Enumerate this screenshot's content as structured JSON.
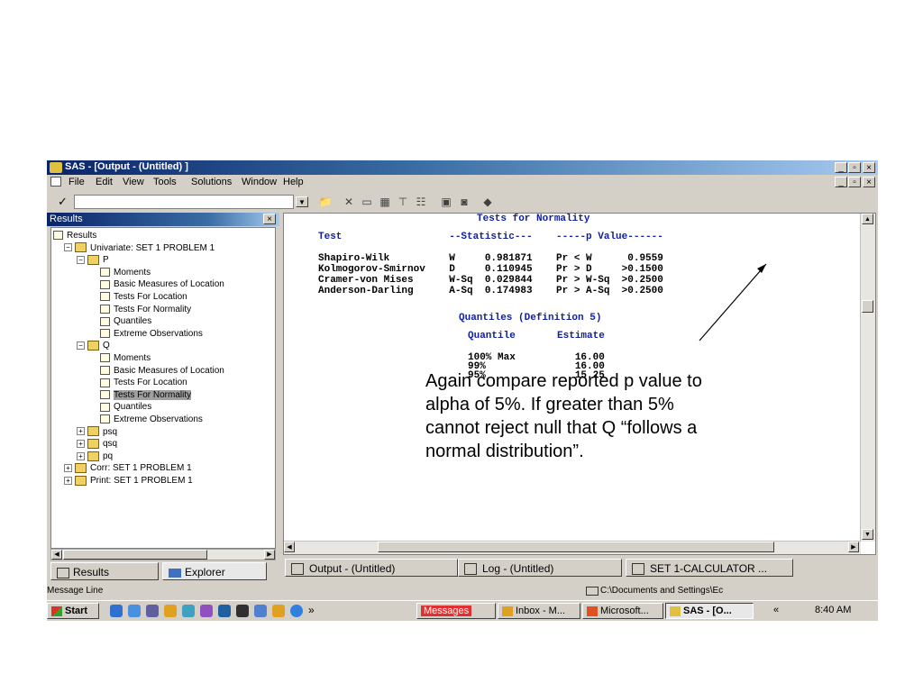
{
  "window": {
    "title": "SAS - [Output - (Untitled) ]",
    "menus": [
      "File",
      "Edit",
      "View",
      "Tools",
      "Solutions",
      "Window",
      "Help"
    ],
    "command_value": "",
    "check_glyph": "✓",
    "min": "_",
    "max": "▫",
    "close": "×"
  },
  "results_panel": {
    "header": "Results",
    "close": "×",
    "tree": [
      {
        "label": "Results",
        "level": 0,
        "kind": "root"
      },
      {
        "label": "Univariate:  SET 1 PROBLEM 1",
        "level": 1,
        "kind": "folder",
        "pm": "−"
      },
      {
        "label": "P",
        "level": 2,
        "kind": "folder",
        "pm": "−"
      },
      {
        "label": "Moments",
        "level": 3,
        "kind": "item"
      },
      {
        "label": "Basic Measures of Location",
        "level": 3,
        "kind": "item"
      },
      {
        "label": "Tests For Location",
        "level": 3,
        "kind": "item"
      },
      {
        "label": "Tests For Normality",
        "level": 3,
        "kind": "item"
      },
      {
        "label": "Quantiles",
        "level": 3,
        "kind": "item"
      },
      {
        "label": "Extreme Observations",
        "level": 3,
        "kind": "item"
      },
      {
        "label": "Q",
        "level": 2,
        "kind": "folder",
        "pm": "−"
      },
      {
        "label": "Moments",
        "level": 3,
        "kind": "item"
      },
      {
        "label": "Basic Measures of Location",
        "level": 3,
        "kind": "item"
      },
      {
        "label": "Tests For Location",
        "level": 3,
        "kind": "item"
      },
      {
        "label": "Tests For Normality",
        "level": 3,
        "kind": "item",
        "selected": true
      },
      {
        "label": "Quantiles",
        "level": 3,
        "kind": "item"
      },
      {
        "label": "Extreme Observations",
        "level": 3,
        "kind": "item"
      },
      {
        "label": "psq",
        "level": 2,
        "kind": "folder",
        "pm": "+"
      },
      {
        "label": "qsq",
        "level": 2,
        "kind": "folder",
        "pm": "+"
      },
      {
        "label": "pq",
        "level": 2,
        "kind": "folder",
        "pm": "+"
      },
      {
        "label": "Corr:  SET 1 PROBLEM 1",
        "level": 1,
        "kind": "folder",
        "pm": "+"
      },
      {
        "label": "Print:  SET 1 PROBLEM 1",
        "level": 1,
        "kind": "folder",
        "pm": "+"
      }
    ],
    "tabs": {
      "results": "Results",
      "explorer": "Explorer"
    }
  },
  "output": {
    "section_title": "Tests for Normality",
    "header_row": "Test                  --Statistic---    -----p Value------",
    "rows": [
      "Shapiro-Wilk          W     0.981871    Pr < W      0.9559",
      "Kolmogorov-Smirnov    D     0.110945    Pr > D     >0.1500",
      "Cramer-von Mises      W-Sq  0.029844    Pr > W-Sq  >0.2500",
      "Anderson-Darling      A-Sq  0.174983    Pr > A-Sq  >0.2500"
    ],
    "quantiles_title": "Quantiles (Definition 5)",
    "quantiles_header": "Quantile       Estimate",
    "quantile_rows": [
      "100% Max          16.00",
      "99%               16.00",
      "95%               15.25"
    ]
  },
  "annotation": "Again compare reported p value to alpha of 5%.  If greater than 5% cannot reject null that Q “follows a normal distribution”.",
  "window_tabs": [
    "Output - (Untitled)",
    "Log - (Untitled)",
    "SET 1-CALCULATOR ..."
  ],
  "status": {
    "message": "Message Line",
    "path": "C:\\Documents and Settings\\Ec"
  },
  "taskbar": {
    "start": "Start",
    "more": "»",
    "items": [
      "Messages",
      "Inbox - M...",
      "Microsoft...",
      "SAS - [O..."
    ],
    "chevron": "«",
    "clock": "8:40 AM"
  }
}
